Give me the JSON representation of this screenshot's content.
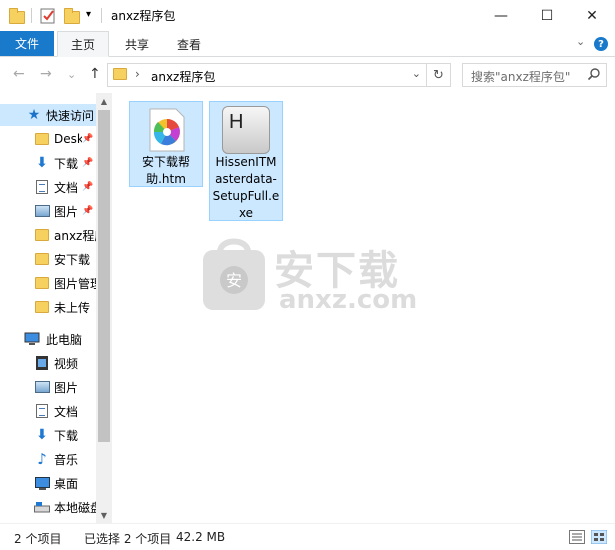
{
  "window": {
    "title": "anxz程序包",
    "minimize_icon": "—",
    "maximize_icon": "☐",
    "close_icon": "✕"
  },
  "ribbon": {
    "tabs": [
      "文件",
      "主页",
      "共享",
      "查看"
    ],
    "active_tab": "主页",
    "expand_icon": "⌄",
    "help_icon": "?"
  },
  "addressbar": {
    "back_icon": "←",
    "forward_icon": "→",
    "recent_icon": "⌄",
    "up_icon": "↑",
    "breadcrumb_sep": "›",
    "path": "anxz程序包",
    "dropdown_icon": "⌄",
    "refresh_icon": "↻"
  },
  "search": {
    "placeholder": "搜索\"anxz程序包\""
  },
  "nav": {
    "quick_access": "快速访问",
    "items": [
      {
        "label": "Desktop",
        "icon": "desktop-folder-icon",
        "pinned": true
      },
      {
        "label": "下载",
        "icon": "download-icon",
        "pinned": true
      },
      {
        "label": "文档",
        "icon": "document-icon",
        "pinned": true
      },
      {
        "label": "图片",
        "icon": "picture-icon",
        "pinned": true
      },
      {
        "label": "anxz程序包",
        "icon": "folder-icon",
        "pinned": false
      },
      {
        "label": "安下载",
        "icon": "folder-icon",
        "pinned": false
      },
      {
        "label": "图片管理",
        "icon": "folder-icon",
        "pinned": false
      },
      {
        "label": "未上传",
        "icon": "folder-icon",
        "pinned": false
      }
    ],
    "this_pc": "此电脑",
    "pc_items": [
      {
        "label": "视频",
        "icon": "video-icon"
      },
      {
        "label": "图片",
        "icon": "picture-icon"
      },
      {
        "label": "文档",
        "icon": "document-icon"
      },
      {
        "label": "下载",
        "icon": "download-icon"
      },
      {
        "label": "音乐",
        "icon": "music-icon"
      },
      {
        "label": "桌面",
        "icon": "desktop-icon"
      },
      {
        "label": "本地磁盘",
        "icon": "drive-icon"
      }
    ],
    "pin_icon": "📌"
  },
  "files": [
    {
      "name_lines": [
        "安下载帮",
        "助.htm"
      ],
      "icon": "colorful-pinwheel-icon",
      "selected": true
    },
    {
      "name_lines": [
        "HissenITM",
        "asterdata-",
        "SetupFull.e",
        "xe"
      ],
      "icon": "installer-h-icon",
      "icon_letter": "H",
      "selected": true
    }
  ],
  "watermark": {
    "text": "安下载",
    "sub": "anxz.com",
    "badge_char": "安"
  },
  "status": {
    "item_count": "2 个项目",
    "selected": "已选择 2 个项目",
    "size": "42.2 MB"
  }
}
